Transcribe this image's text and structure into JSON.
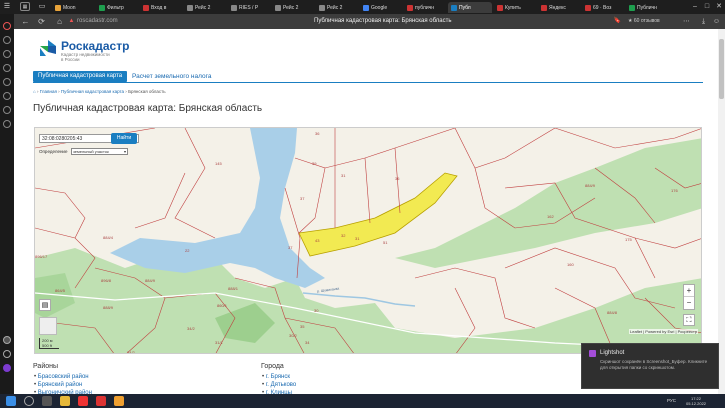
{
  "browser": {
    "tabs": [
      {
        "label": "Moon",
        "color": "#e8a33a"
      },
      {
        "label": "Фильтр",
        "color": "#1e9e4e"
      },
      {
        "label": "Вход в",
        "color": "#c33"
      },
      {
        "label": "Рейс 2",
        "color": "#888"
      },
      {
        "label": "RIES / Р",
        "color": "#888"
      },
      {
        "label": "Рейс 2",
        "color": "#888"
      },
      {
        "label": "Рейс 2",
        "color": "#888"
      },
      {
        "label": "Google",
        "color": "#4285f4"
      },
      {
        "label": "публичн",
        "color": "#c33"
      },
      {
        "label": "Публ",
        "color": "#1a7ec1",
        "active": true
      },
      {
        "label": "Купить",
        "color": "#c33"
      },
      {
        "label": "Яндекс",
        "color": "#c33"
      },
      {
        "label": "69 · Воз",
        "color": "#c33"
      },
      {
        "label": "Публичн",
        "color": "#1e9e4e"
      }
    ],
    "url": "roscadastr.com",
    "page_title": "Публичная кадастровая карта: Брянская область",
    "reviews": "★ 60 отзывов"
  },
  "header": {
    "brand": "Роскадастр",
    "tagline": "Кадастр недвижимости в России"
  },
  "nav": {
    "tab_map": "Публичная кадастровая карта",
    "tab_calc": "Расчет земельного налога"
  },
  "breadcrumbs": {
    "home": "Главная",
    "map": "Публичная кадастровая карта",
    "current": "Брянская область",
    "sep": "›"
  },
  "heading": "Публичная кадастровая карта: Брянская область",
  "map": {
    "search_value": "32:08:0280205:43",
    "find_label": "Найти",
    "definition_label": "Определение",
    "definition_select": "земельный участок",
    "scale_m": "200 м",
    "scale_ft": "500 ft",
    "zoom_in": "+",
    "zoom_out": "−",
    "attribution": "Leaflet | Powered by Esri | Росреестр",
    "parcel_labels": [
      "145",
      "36",
      "39",
      "37",
      "31",
      "36",
      "51",
      "37",
      "43",
      "32",
      "31",
      "884/9",
      "176",
      "162",
      "160",
      "175",
      "884/8",
      "888/1",
      "896/17",
      "896/8",
      "864/5",
      "884/9",
      "888/9",
      "30",
      "35",
      "34/2",
      "24/2",
      "860/1",
      "884/4",
      "22",
      "30/2",
      "31/1",
      "34"
    ],
    "water_label": "р. Шумиханка"
  },
  "sections": {
    "districts_title": "Районы",
    "districts": [
      "Брасовский район",
      "Брянский район",
      "Выгоничский район"
    ],
    "cities_title": "Города",
    "cities": [
      "г. Брянск",
      "г. Дятьково",
      "г. Клинцы"
    ]
  },
  "notification": {
    "title": "Lightshot",
    "message": "Скриншот сохранён в Screenshot_Буфер. Кликните для открытия папки со скриншотом."
  },
  "taskbar": {
    "lang": "РУС",
    "time": "17:22",
    "date": "05.12.2022"
  }
}
